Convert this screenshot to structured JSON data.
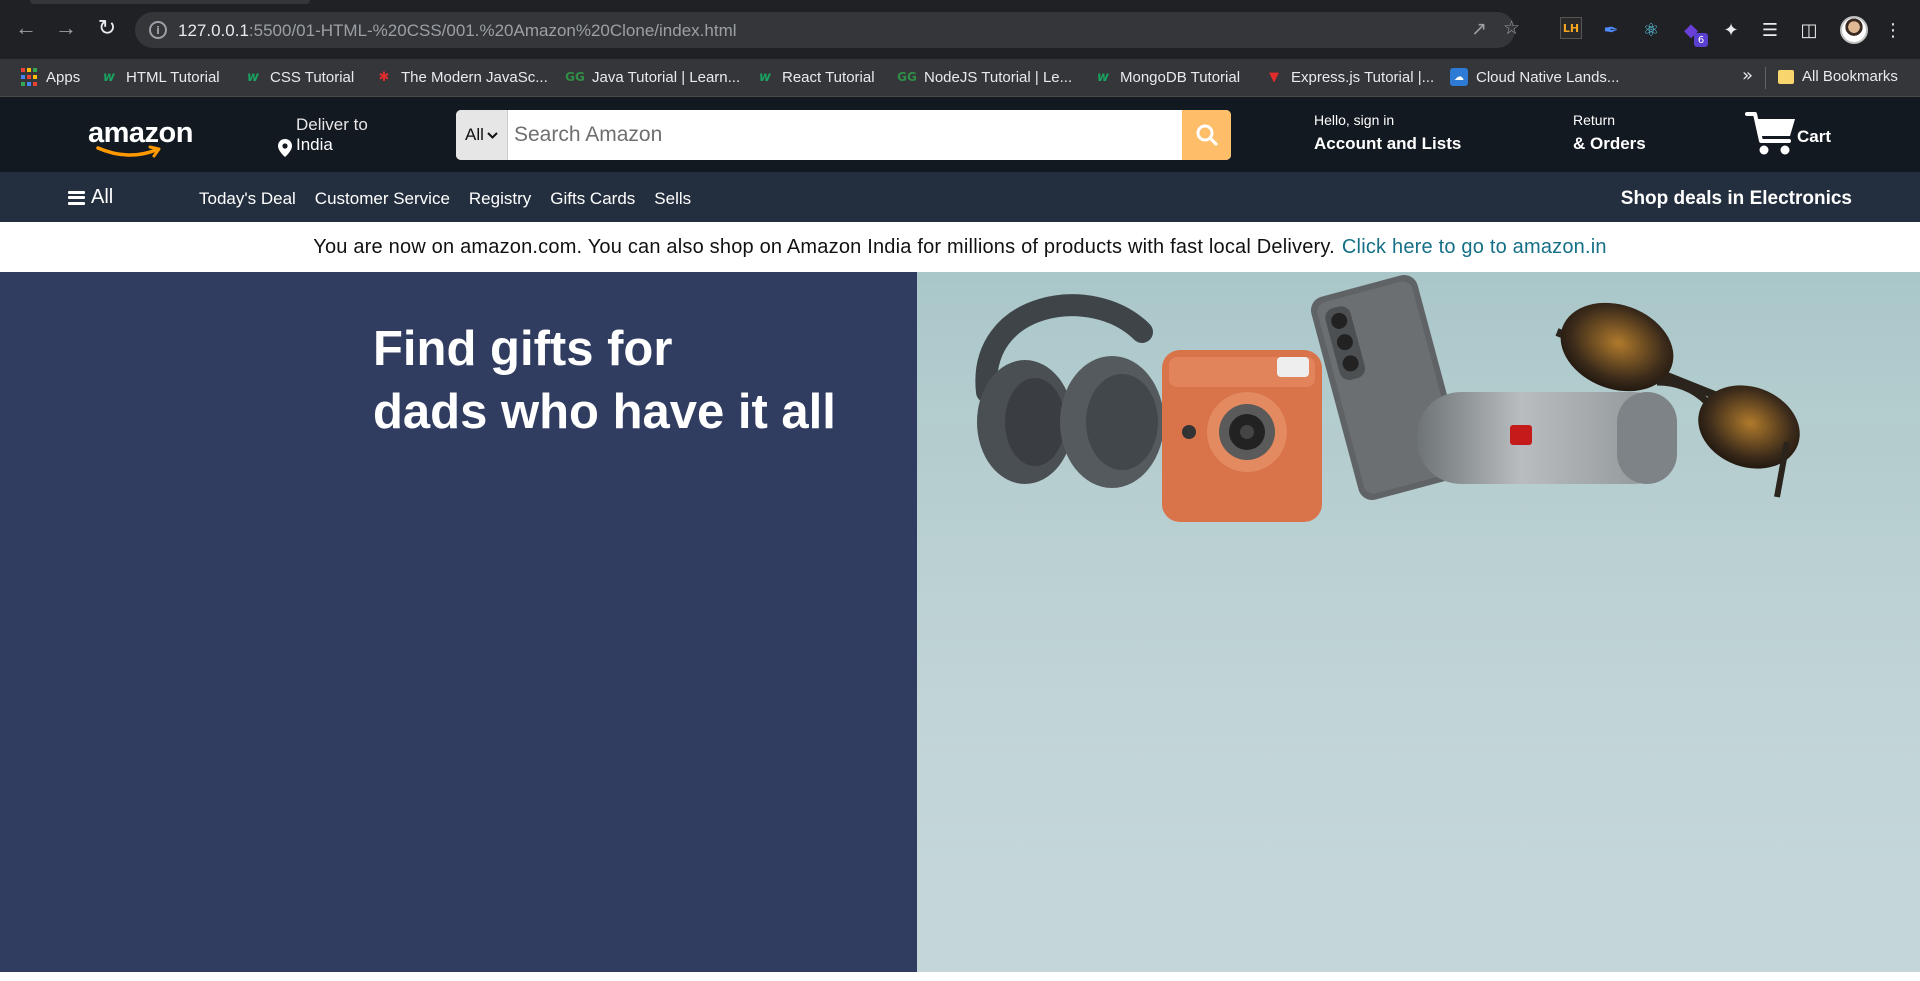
{
  "browser": {
    "url_host": "127.0.0.1",
    "url_path": ":5500/01-HTML-%20CSS/001.%20Amazon%20Clone/index.html",
    "extension_badge": "6",
    "extension_lh": "LH",
    "bookmarks": [
      {
        "label": "Apps",
        "icon": "apps-grid-icon"
      },
      {
        "label": "HTML Tutorial",
        "icon": "w3schools-icon"
      },
      {
        "label": "CSS Tutorial",
        "icon": "w3schools-icon"
      },
      {
        "label": "The Modern JavaSc...",
        "icon": "javascript-info-icon"
      },
      {
        "label": "Java Tutorial | Learn...",
        "icon": "geeksforgeeks-icon"
      },
      {
        "label": "React Tutorial",
        "icon": "w3schools-icon"
      },
      {
        "label": "NodeJS Tutorial | Le...",
        "icon": "geeksforgeeks-icon"
      },
      {
        "label": "MongoDB Tutorial",
        "icon": "w3schools-icon"
      },
      {
        "label": "Express.js Tutorial |...",
        "icon": "tutorialspoint-icon"
      },
      {
        "label": "Cloud Native Lands...",
        "icon": "cncf-icon"
      }
    ],
    "bookmarks_more": "»",
    "all_bookmarks": "All Bookmarks"
  },
  "header": {
    "logo": "amazon",
    "deliver_to": "Deliver to",
    "deliver_location": "India",
    "search_category": "All",
    "search_placeholder": "Search Amazon",
    "account_greeting": "Hello, sign in",
    "account_label": "Account and Lists",
    "returns_small": "Return",
    "returns_label": "& Orders",
    "cart_label": "Cart"
  },
  "subnav": {
    "all_label": "All",
    "links": [
      "Today's Deal",
      "Customer Service",
      "Registry",
      "Gifts Cards",
      "Sells"
    ],
    "deals_label": "Shop deals in Electronics"
  },
  "notice": {
    "text": "You are now on amazon.com. You can also shop on Amazon India for millions of products with fast local Delivery.",
    "link": "Click here to go to amazon.in"
  },
  "hero": {
    "title_line1": "Find gifts for",
    "title_line2": "dads who have it all"
  },
  "colors": {
    "nav_bg": "#131921",
    "subnav_bg": "#232f3e",
    "search_button": "#febd69",
    "hero_left_bg": "#303d61",
    "link": "#157087"
  }
}
